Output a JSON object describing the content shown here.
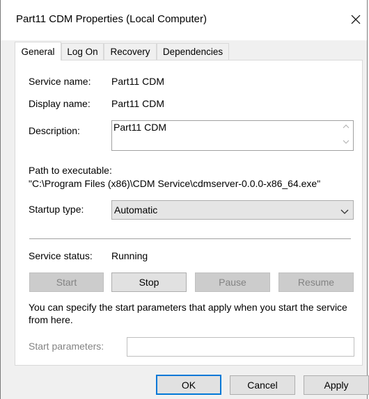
{
  "window": {
    "title": "Part11 CDM Properties (Local Computer)"
  },
  "tabs": [
    {
      "label": "General",
      "active": true
    },
    {
      "label": "Log On",
      "active": false
    },
    {
      "label": "Recovery",
      "active": false
    },
    {
      "label": "Dependencies",
      "active": false
    }
  ],
  "general": {
    "service_name_label": "Service name:",
    "service_name": "Part11 CDM",
    "display_name_label": "Display name:",
    "display_name": "Part11 CDM",
    "description_label": "Description:",
    "description": "Part11 CDM",
    "path_label": "Path to executable:",
    "path": "\"C:\\Program Files (x86)\\CDM Service\\cdmserver-0.0.0-x86_64.exe\"",
    "startup_type_label": "Startup type:",
    "startup_type": "Automatic",
    "service_status_label": "Service status:",
    "service_status": "Running",
    "buttons": {
      "start": "Start",
      "stop": "Stop",
      "pause": "Pause",
      "resume": "Resume"
    },
    "hint_line1": "You can specify the start parameters that apply when you start the service",
    "hint_line2": "from here.",
    "start_params_label": "Start parameters:",
    "start_params_value": ""
  },
  "footer": {
    "ok": "OK",
    "cancel": "Cancel",
    "apply": "Apply"
  },
  "colors": {
    "accent": "#0078d7",
    "disabled_text": "#838383"
  }
}
